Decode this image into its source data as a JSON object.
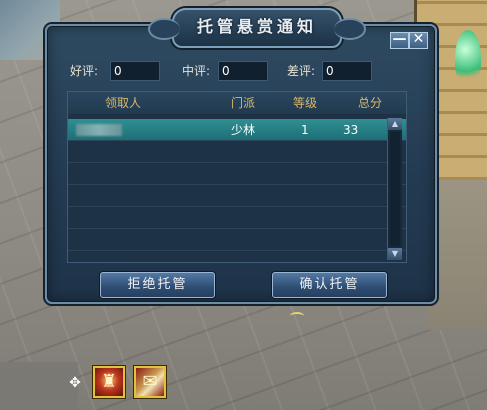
{
  "dialog": {
    "title": "托管悬赏通知",
    "minimize_label": "—",
    "close_label": "✕",
    "ratings": {
      "good_label": "好评:",
      "good_value": "0",
      "neutral_label": "中评:",
      "neutral_value": "0",
      "bad_label": "差评:",
      "bad_value": "0"
    },
    "table": {
      "headers": [
        "领取人",
        "门派",
        "等级",
        "总分"
      ],
      "rows": [
        {
          "claimer": "",
          "sect": "少林",
          "level": "1",
          "score": "33"
        }
      ]
    },
    "scroll_up_icon": "triangle-up-icon",
    "scroll_down_icon": "triangle-down-icon",
    "reject_button": "拒绝托管",
    "confirm_button": "确认托管"
  },
  "hud": {
    "move_icon": "move-cross-icon",
    "buffs": [
      "shield-emblem-icon",
      "scroll-emblem-icon"
    ]
  }
}
